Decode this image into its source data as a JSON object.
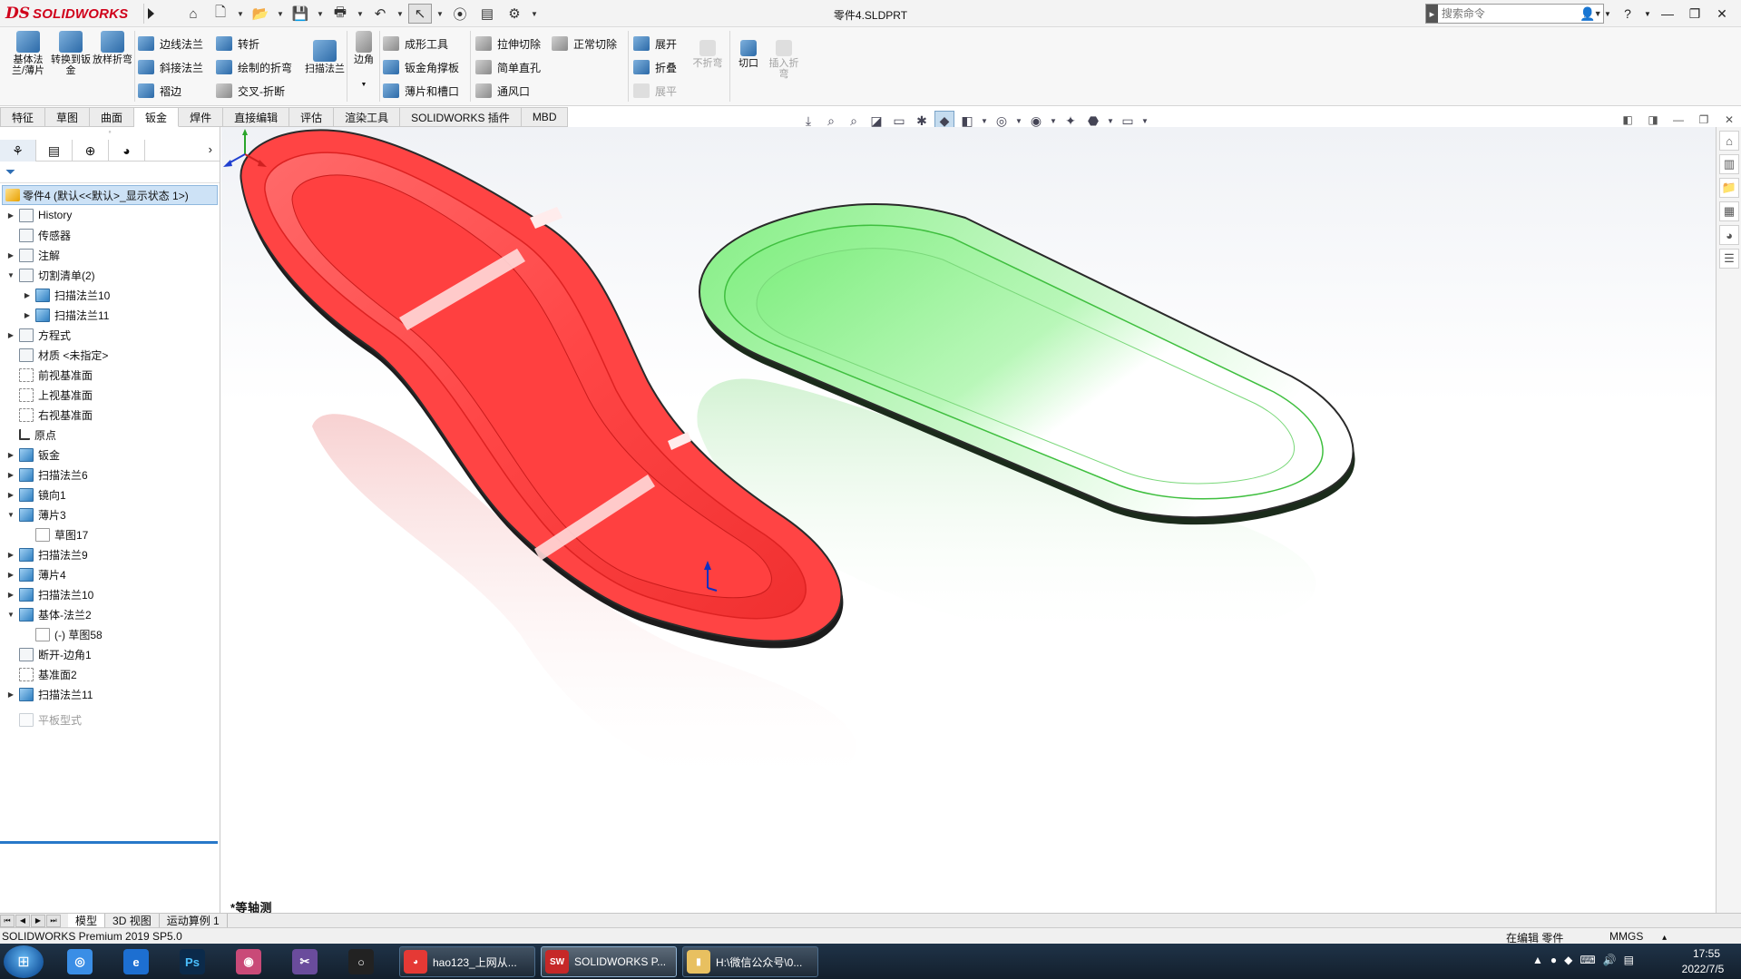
{
  "app": {
    "brand": "SOLIDWORKS",
    "document_title": "零件4.SLDPRT",
    "search_placeholder": "搜索命令"
  },
  "quick_toolbar": [
    "home-icon",
    "new-file-icon",
    "open-file-icon",
    "save-icon",
    "print-icon",
    "undo-icon",
    "select-icon",
    "traffic-light-icon",
    "file-properties-icon",
    "options-gear-icon"
  ],
  "ribbon": {
    "base_flange": "基体法兰/薄片",
    "convert_to_sheet": "转换到钣金",
    "lofted_bend": "放样折弯",
    "edge_flange": "边线法兰",
    "miter_flange": "斜接法兰",
    "hem": "褶边",
    "jog": "转折",
    "sketched_bend": "绘制的折弯",
    "cross_break": "交叉-折断",
    "swept_flange": "扫描法兰",
    "corners": "边角",
    "forming_tool": "成形工具",
    "gusset": "钣金角撑板",
    "tab_and_slot": "薄片和槽口",
    "extruded_cut": "拉伸切除",
    "simple_hole": "简单直孔",
    "vent": "通风口",
    "normal_cut": "正常切除",
    "unfold": "展开",
    "fold": "折叠",
    "flatten": "展平",
    "no_bends": "不折弯",
    "rip": "切口",
    "insert_bends": "插入折弯"
  },
  "command_tabs": [
    "特征",
    "草图",
    "曲面",
    "钣金",
    "焊件",
    "直接编辑",
    "评估",
    "渲染工具",
    "SOLIDWORKS 插件",
    "MBD"
  ],
  "active_command_tab": "钣金",
  "feature_tree": {
    "root": "零件4  (默认<<默认>_显示状态 1>)",
    "items": [
      {
        "label": "History",
        "icon": "history-folder-icon",
        "expand": "▶"
      },
      {
        "label": "传感器",
        "icon": "sensor-icon",
        "expand": ""
      },
      {
        "label": "注解",
        "icon": "annotations-icon",
        "expand": "▶"
      },
      {
        "label": "切割清单(2)",
        "icon": "cut-list-icon",
        "expand": "▼"
      },
      {
        "label": "扫描法兰10",
        "icon": "sheet-metal-body-icon",
        "expand": "▶"
      },
      {
        "label": "扫描法兰11",
        "icon": "sheet-metal-body-icon",
        "expand": "▶"
      },
      {
        "label": "方程式",
        "icon": "equations-icon",
        "expand": "▶"
      },
      {
        "label": "材质 <未指定>",
        "icon": "material-icon",
        "expand": ""
      },
      {
        "label": "前视基准面",
        "icon": "plane-icon",
        "expand": ""
      },
      {
        "label": "上视基准面",
        "icon": "plane-icon",
        "expand": ""
      },
      {
        "label": "右视基准面",
        "icon": "plane-icon",
        "expand": ""
      },
      {
        "label": "原点",
        "icon": "origin-icon",
        "expand": ""
      },
      {
        "label": "钣金",
        "icon": "sheet-metal-icon",
        "expand": "▶"
      },
      {
        "label": "扫描法兰6",
        "icon": "swept-flange-icon",
        "expand": "▶"
      },
      {
        "label": "镜向1",
        "icon": "mirror-icon",
        "expand": "▶"
      },
      {
        "label": "薄片3",
        "icon": "tab-icon",
        "expand": "▼"
      },
      {
        "label": "草图17",
        "icon": "sketch-icon",
        "expand": ""
      },
      {
        "label": "扫描法兰9",
        "icon": "swept-flange-icon",
        "expand": "▶"
      },
      {
        "label": "薄片4",
        "icon": "tab-icon",
        "expand": "▶"
      },
      {
        "label": "扫描法兰10",
        "icon": "swept-flange-icon",
        "expand": "▶"
      },
      {
        "label": "基体-法兰2",
        "icon": "base-flange-icon",
        "expand": "▼"
      },
      {
        "label": "(-) 草图58",
        "icon": "sketch-icon",
        "expand": ""
      },
      {
        "label": "断开-边角1",
        "icon": "break-corner-icon",
        "expand": ""
      },
      {
        "label": "基准面2",
        "icon": "plane-icon",
        "expand": ""
      },
      {
        "label": "扫描法兰11",
        "icon": "swept-flange-icon",
        "expand": "▶"
      },
      {
        "label": "平板型式",
        "icon": "flat-pattern-icon",
        "expand": ""
      }
    ]
  },
  "viewport": {
    "view_name": "*等轴测",
    "shapes": [
      {
        "name": "red-tray",
        "color": "#ff4a4a"
      },
      {
        "name": "green-tray",
        "color": "#7ff07f"
      }
    ]
  },
  "bottom_tabs": [
    "模型",
    "3D 视图",
    "运动算例 1"
  ],
  "status": {
    "product": "SOLIDWORKS Premium 2019 SP5.0",
    "mode": "在编辑 零件",
    "units": "MMGS"
  },
  "taskbar": {
    "tasks": [
      {
        "label": "hao123_上网从...",
        "color": "#e53935"
      },
      {
        "label": "SOLIDWORKS P...",
        "color": "#c62828"
      },
      {
        "label": "H:\\微信公众号\\0...",
        "color": "#e8c060"
      }
    ],
    "time": "17:55",
    "date": "2022/7/5"
  }
}
